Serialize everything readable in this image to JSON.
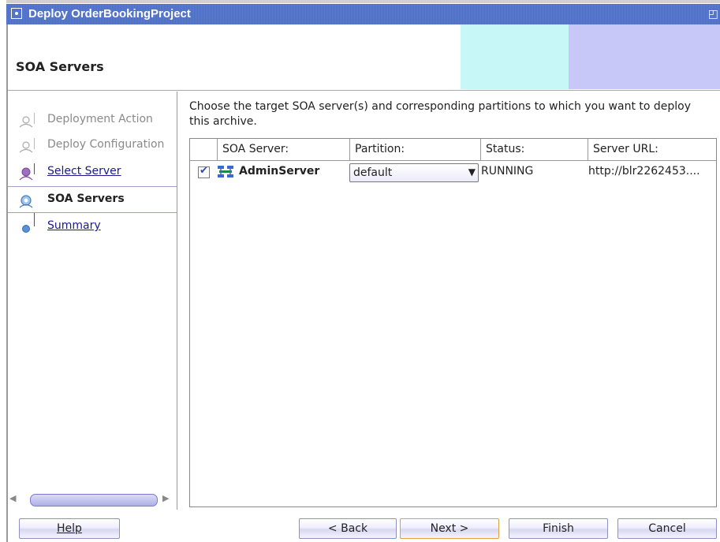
{
  "window": {
    "title": "Deploy OrderBookingProject"
  },
  "header": {
    "title": "SOA Servers"
  },
  "nav": {
    "items": [
      {
        "label": "Deployment Action",
        "state": "disabled"
      },
      {
        "label": "Deploy Configuration",
        "state": "disabled"
      },
      {
        "label": "Select Server",
        "state": "link"
      },
      {
        "label": "SOA Servers",
        "state": "active"
      },
      {
        "label": "Summary",
        "state": "link"
      }
    ]
  },
  "main": {
    "instruction": "Choose the target SOA server(s) and corresponding partitions to which you want to deploy this archive.",
    "table": {
      "columns": [
        "SOA Server:",
        "Partition:",
        "Status:",
        "Server URL:"
      ],
      "rows": [
        {
          "checked": true,
          "server": "AdminServer",
          "partition": "default",
          "status": "RUNNING",
          "url": "http://blr2262453...."
        }
      ]
    }
  },
  "buttons": {
    "help": "Help",
    "back": "< Back",
    "next": "Next >",
    "finish": "Finish",
    "cancel": "Cancel"
  },
  "colors": {
    "titlebar": "#5577cc",
    "header_cyan": "#c8f7f7",
    "header_lavender": "#c8c8f8",
    "link": "#1a1a8c"
  }
}
